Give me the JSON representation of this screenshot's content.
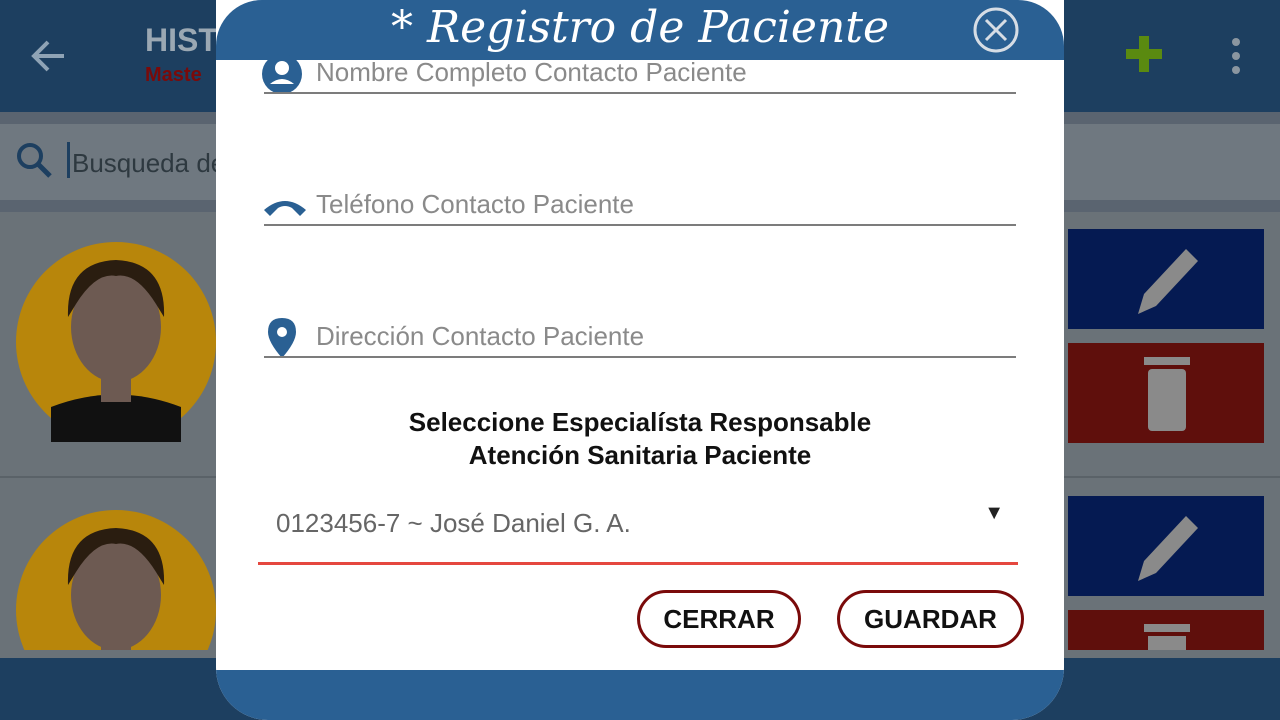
{
  "appbar": {
    "title": "HISTO",
    "subtitle": "Maste"
  },
  "search": {
    "placeholder": "Busqueda de"
  },
  "dialog": {
    "title": "* Registro de Paciente",
    "fields": [
      {
        "placeholder": "Nombre Completo Contacto Paciente",
        "icon": "person-icon"
      },
      {
        "placeholder": "Teléfono Contacto Paciente",
        "icon": "phone-icon"
      },
      {
        "placeholder": "Dirección Contacto Paciente",
        "icon": "location-pin-icon"
      }
    ],
    "select_title_line1": "Seleccione Especialísta Responsable",
    "select_title_line2": "Atención Sanitaria Paciente",
    "select_value": "0123456-7 ~ José Daniel G. A.",
    "select_arrow": "▼",
    "cerrar_label": "CERRAR",
    "guardar_label": "GUARDAR"
  },
  "colors": {
    "header_blue": "#2a6093",
    "button_border": "#7a0a0a",
    "select_underline": "#e5473f",
    "edit_blue": "#051a52",
    "delete_red": "#5f0f0c"
  }
}
